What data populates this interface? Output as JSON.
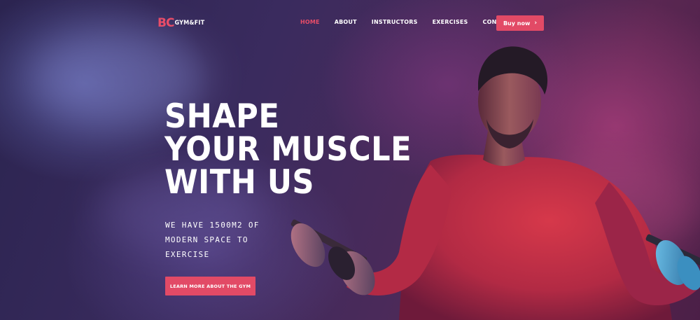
{
  "brand": {
    "mark": "BC",
    "name": "GYM&FIT"
  },
  "nav": {
    "items": [
      {
        "label": "HOME",
        "active": true
      },
      {
        "label": "ABOUT",
        "active": false
      },
      {
        "label": "INSTRUCTORS",
        "active": false
      },
      {
        "label": "EXERCISES",
        "active": false
      },
      {
        "label": "CONTACT",
        "active": false
      }
    ],
    "buy_label": "Buy now",
    "buy_icon": "chevron-right-icon"
  },
  "hero": {
    "headline_lines": [
      "SHAPE",
      "YOUR MUSCLE",
      "WITH US"
    ],
    "sub_lines": [
      "WE HAVE 1500M2 OF",
      "MODERN SPACE TO",
      "EXERCISE"
    ],
    "cta_label": "LEARN MORE ABOUT THE GYM"
  },
  "colors": {
    "accent": "#e24a66",
    "text": "#ffffff"
  }
}
